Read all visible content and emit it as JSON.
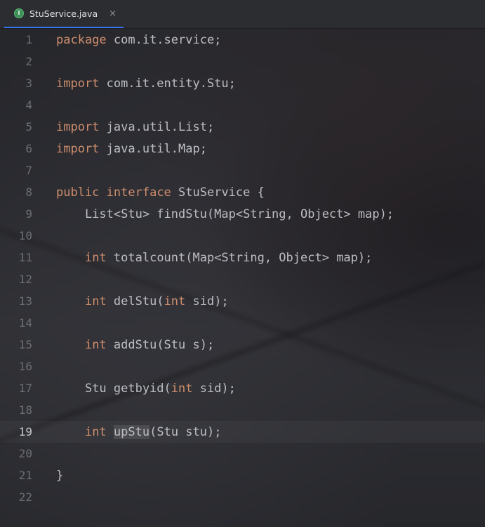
{
  "tab": {
    "icon": "I",
    "label": "StuService.java",
    "close": "×"
  },
  "lines": [
    {
      "n": "1",
      "parts": [
        [
          "kw",
          "package"
        ],
        [
          "txt",
          " com.it.service;"
        ]
      ]
    },
    {
      "n": "2",
      "parts": []
    },
    {
      "n": "3",
      "parts": [
        [
          "kw",
          "import"
        ],
        [
          "txt",
          " com.it.entity.Stu;"
        ]
      ]
    },
    {
      "n": "4",
      "parts": []
    },
    {
      "n": "5",
      "parts": [
        [
          "kw",
          "import"
        ],
        [
          "txt",
          " java.util.List;"
        ]
      ]
    },
    {
      "n": "6",
      "parts": [
        [
          "kw",
          "import"
        ],
        [
          "txt",
          " java.util.Map;"
        ]
      ]
    },
    {
      "n": "7",
      "parts": []
    },
    {
      "n": "8",
      "parts": [
        [
          "kw",
          "public"
        ],
        [
          "txt",
          " "
        ],
        [
          "kw",
          "interface"
        ],
        [
          "txt",
          " StuService {"
        ]
      ]
    },
    {
      "n": "9",
      "parts": [
        [
          "txt",
          "    List<Stu> findStu(Map<String, Object> map);"
        ]
      ]
    },
    {
      "n": "10",
      "parts": []
    },
    {
      "n": "11",
      "parts": [
        [
          "txt",
          "    "
        ],
        [
          "kw",
          "int"
        ],
        [
          "txt",
          " totalcount(Map<String, Object> map);"
        ]
      ]
    },
    {
      "n": "12",
      "parts": []
    },
    {
      "n": "13",
      "parts": [
        [
          "txt",
          "    "
        ],
        [
          "kw",
          "int"
        ],
        [
          "txt",
          " delStu("
        ],
        [
          "kw",
          "int"
        ],
        [
          "txt",
          " sid);"
        ]
      ]
    },
    {
      "n": "14",
      "parts": []
    },
    {
      "n": "15",
      "parts": [
        [
          "txt",
          "    "
        ],
        [
          "kw",
          "int"
        ],
        [
          "txt",
          " addStu(Stu s);"
        ]
      ]
    },
    {
      "n": "16",
      "parts": []
    },
    {
      "n": "17",
      "parts": [
        [
          "txt",
          "    Stu getbyid("
        ],
        [
          "kw",
          "int"
        ],
        [
          "txt",
          " sid);"
        ]
      ]
    },
    {
      "n": "18",
      "parts": []
    },
    {
      "n": "19",
      "parts": [
        [
          "txt",
          "    "
        ],
        [
          "kw",
          "int"
        ],
        [
          "txt",
          " "
        ],
        [
          "hl",
          "upStu"
        ],
        [
          "txt",
          "(Stu stu);"
        ]
      ],
      "current": true
    },
    {
      "n": "20",
      "parts": []
    },
    {
      "n": "21",
      "parts": [
        [
          "txt",
          "}"
        ]
      ]
    },
    {
      "n": "22",
      "parts": []
    }
  ],
  "colors": {
    "keyword": "#cf8e6d",
    "text": "#bcbec4",
    "line_number": "#6b6e75",
    "tab_underline": "#3574f0"
  }
}
